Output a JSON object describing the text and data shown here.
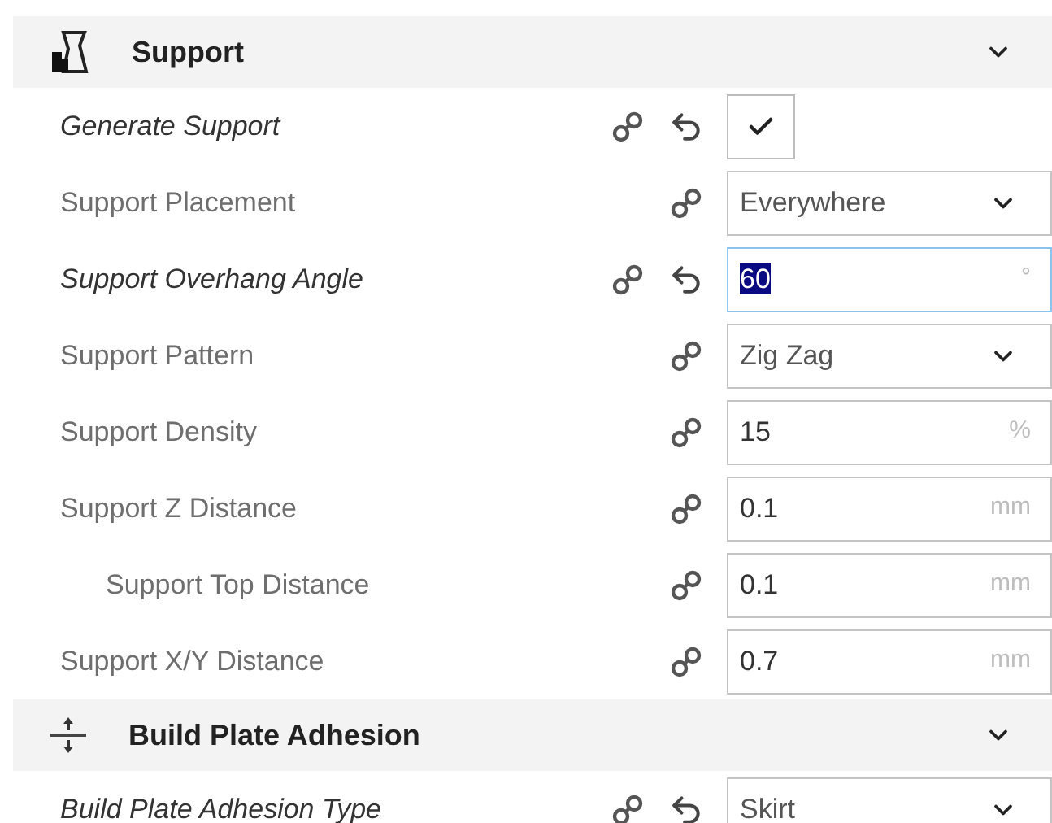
{
  "sections": [
    {
      "title": "Support",
      "kind": "support",
      "expanded": true,
      "settings": [
        {
          "label": "Generate Support",
          "kind": "checkbox",
          "modified": true,
          "checked": true
        },
        {
          "label": "Support Placement",
          "kind": "select",
          "modified": false,
          "value": "Everywhere"
        },
        {
          "label": "Support Overhang Angle",
          "kind": "number",
          "modified": true,
          "value": "60",
          "unit": "°",
          "focused": true,
          "value_selected": true
        },
        {
          "label": "Support Pattern",
          "kind": "select",
          "modified": false,
          "value": "Zig Zag"
        },
        {
          "label": "Support Density",
          "kind": "number",
          "modified": false,
          "value": "15",
          "unit": "%",
          "focused": false,
          "value_selected": false
        },
        {
          "label": "Support Z Distance",
          "kind": "number",
          "modified": false,
          "value": "0.1",
          "unit": "mm",
          "focused": false,
          "value_selected": false,
          "children": [
            {
              "label": "Support Top Distance",
              "kind": "number",
              "modified": false,
              "value": "0.1",
              "unit": "mm",
              "focused": false,
              "value_selected": false
            }
          ]
        },
        {
          "label": "Support X/Y Distance",
          "kind": "number",
          "modified": false,
          "value": "0.7",
          "unit": "mm",
          "focused": false,
          "value_selected": false
        }
      ]
    },
    {
      "title": "Build Plate Adhesion",
      "kind": "adhesion",
      "expanded": true,
      "settings": [
        {
          "label": "Build Plate Adhesion Type",
          "kind": "select",
          "modified": true,
          "value": "Skirt"
        }
      ]
    }
  ]
}
